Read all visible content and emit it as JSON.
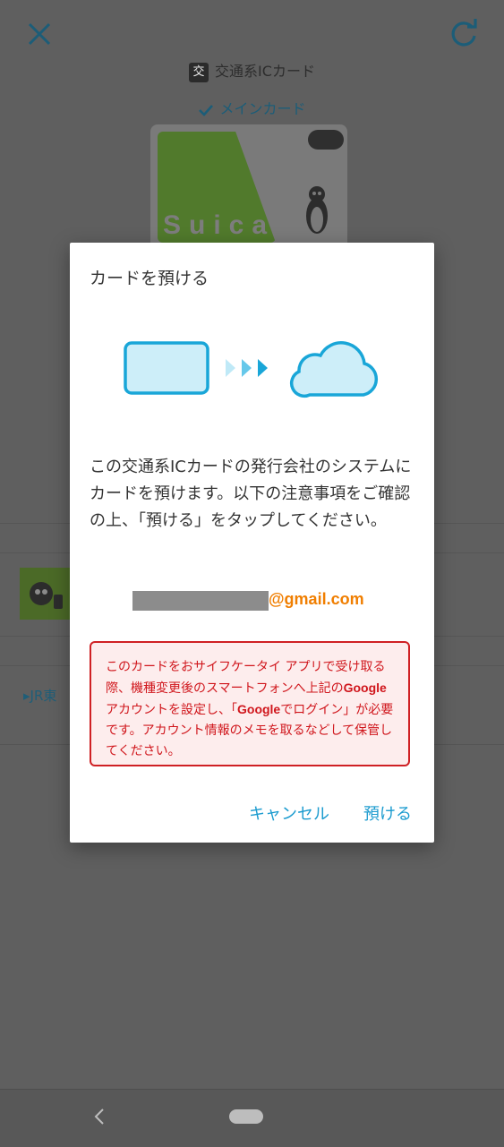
{
  "background": {
    "card_type_badge": "交",
    "card_type_label": "交通系ICカード",
    "main_card_label": "メインカード",
    "card_brand_text": "Suica",
    "list_link_text": "JR東"
  },
  "dialog": {
    "title": "カードを預ける",
    "body": "この交通系ICカードの発行会社のシステムにカードを預けます。以下の注意事項をご確認の上、「預ける」をタップしてください。",
    "email_domain": "@gmail.com",
    "warning_part1": "このカードをおサイフケータイ アプリで受け取る際、機種変更後のスマートフォンへ上記の",
    "warning_google1": "Google",
    "warning_part2": "アカウントを設定し、「",
    "warning_google2": "Google",
    "warning_part3": "でログイン」が必要です。アカウント情報のメモを取るなどして保管してください。",
    "cancel_label": "キャンセル",
    "deposit_label": "預ける"
  },
  "colors": {
    "accent": "#1b9bcf",
    "email_orange": "#f07e00",
    "warning_red": "#d0161c",
    "warning_bg": "#fdeded"
  }
}
